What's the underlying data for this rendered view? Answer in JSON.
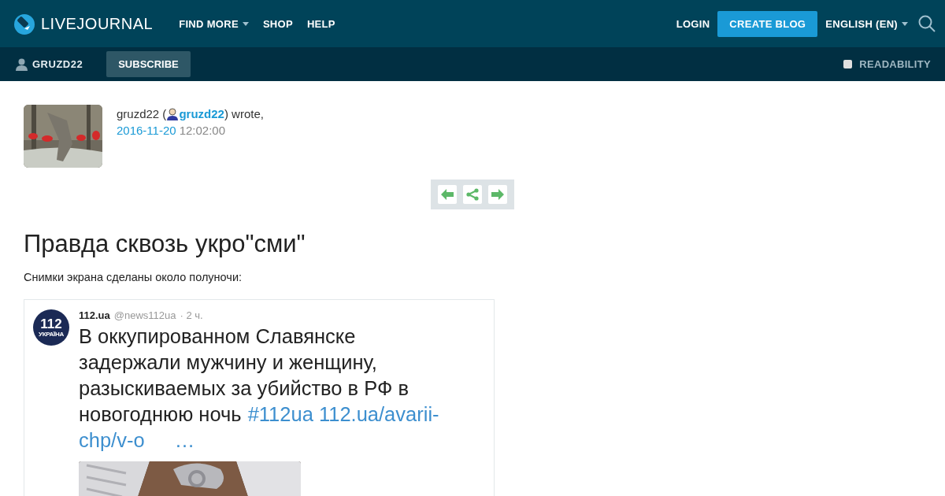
{
  "header": {
    "logo": "LIVEJOURNAL",
    "nav": [
      {
        "label": "FIND MORE",
        "dropdown": true
      },
      {
        "label": "SHOP",
        "dropdown": false
      },
      {
        "label": "HELP",
        "dropdown": false
      }
    ],
    "login": "LOGIN",
    "create_blog": "CREATE BLOG",
    "language": "ENGLISH (EN)"
  },
  "subbar": {
    "user": "GRUZD22",
    "subscribe": "SUBSCRIBE",
    "readability": {
      "label": "READABILITY",
      "checked": false
    }
  },
  "post": {
    "author": "gruzd22 (",
    "author_link": "gruzd22",
    "wrote": ") wrote,",
    "date": "2016-11-20",
    "time": "12:02:00",
    "title": "Правда сквозь укро\"сми\"",
    "intro": "Снимки экрана сделаны около полуночи:",
    "tweet": {
      "logo_number": "112",
      "logo_caption": "УКРАЇНА",
      "name": "112.ua",
      "handle": "@news112ua",
      "age": "· 2 ч.",
      "lines": [
        [
          {
            "kind": "text",
            "text": "В оккупированном Славянске"
          }
        ],
        [
          {
            "kind": "text",
            "text": "задержали мужчину и женщину,"
          }
        ],
        [
          {
            "kind": "text",
            "text": "разыскиваемых за убийство в РФ в"
          }
        ],
        [
          {
            "kind": "text",
            "text": "новогоднюю ночь"
          },
          {
            "kind": "link",
            "text": "#112ua 112.ua/avarii-"
          }
        ],
        [
          {
            "kind": "link",
            "text": "chp/v-o"
          },
          {
            "kind": "more",
            "text": "…"
          }
        ]
      ],
      "photo": {
        "kind": "picture"
      }
    }
  }
}
